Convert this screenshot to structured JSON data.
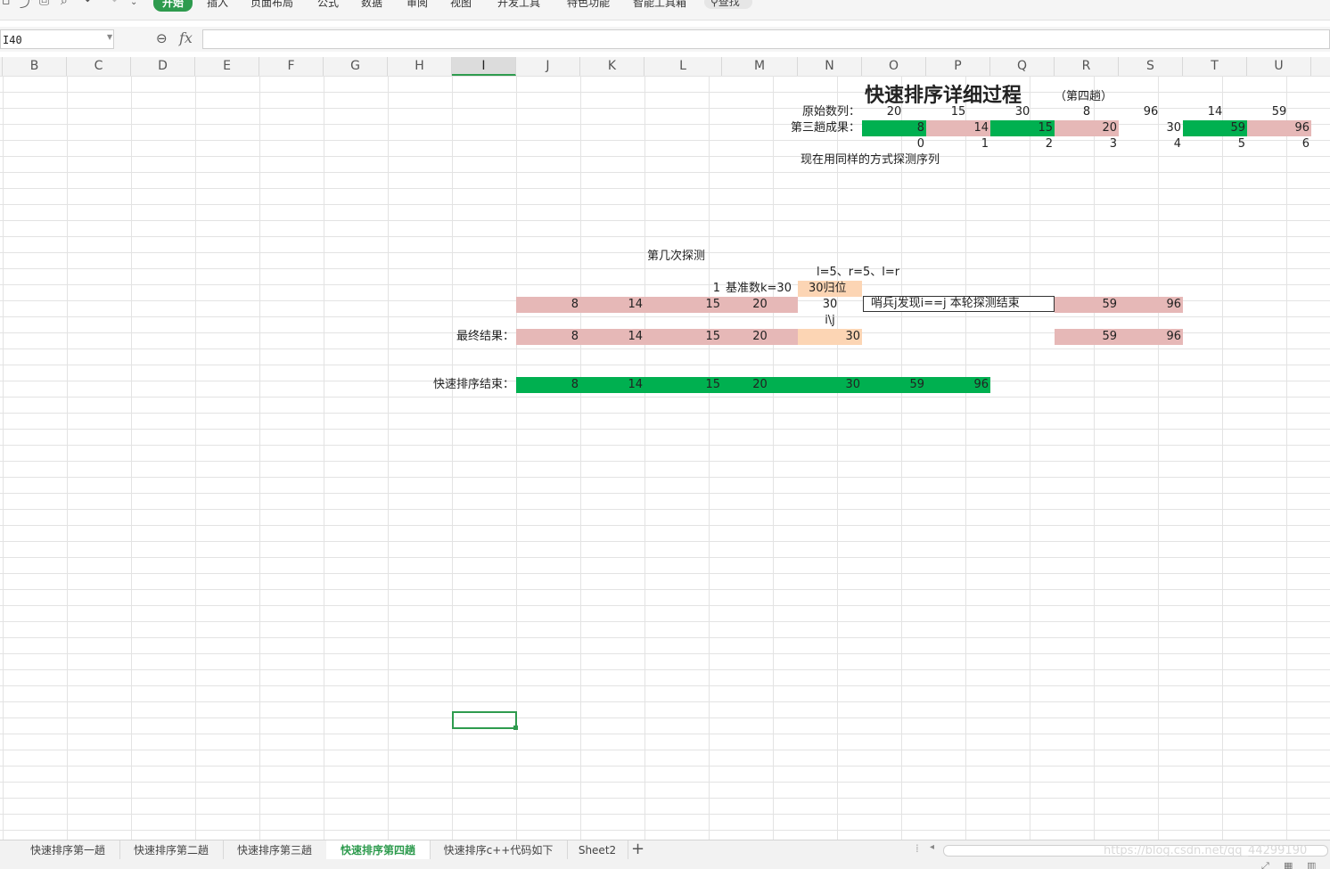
{
  "ribbon": {
    "tabs": [
      "开始",
      "插入",
      "页面布局",
      "公式",
      "数据",
      "审阅",
      "视图",
      "开发工具",
      "特色功能",
      "智能工具箱"
    ],
    "active_tab": "开始",
    "search_label": "查找"
  },
  "formula_bar": {
    "cell_ref": "I40",
    "fx_label": "fx",
    "formula": ""
  },
  "columns": [
    "B",
    "C",
    "D",
    "E",
    "F",
    "G",
    "H",
    "I",
    "J",
    "K",
    "L",
    "M",
    "N",
    "O",
    "P",
    "Q",
    "R",
    "S",
    "T",
    "U"
  ],
  "selected_column": "I",
  "sheet": {
    "title": "快速排序详细过程",
    "subtitle": "（第四趟）",
    "original_label": "原始数列：",
    "original_values": [
      "20",
      "15",
      "30",
      "8",
      "96",
      "14",
      "59"
    ],
    "third_pass_label": "第三趟成果：",
    "third_pass_values": [
      "8",
      "14",
      "15",
      "20",
      "30",
      "59",
      "96"
    ],
    "indices": [
      "0",
      "1",
      "2",
      "3",
      "4",
      "5",
      "6"
    ],
    "note": "现在用同样的方式探测序列",
    "probe_label": "第几次探测",
    "probe_pointers": "l=5、r=5、l=r",
    "probe_number": "1",
    "pivot_label": "基准数k=30",
    "pivot_home": "30归位",
    "probe_row": [
      "8",
      "14",
      "15",
      "20",
      "30"
    ],
    "sentinel_message": "哨兵j发现i==j 本轮探测结束",
    "probe_row_tail": [
      "59",
      "96"
    ],
    "pointer_label": "i\\j",
    "final_label": "最终结果：",
    "final_values": [
      "8",
      "14",
      "15",
      "20",
      "30"
    ],
    "final_tail": [
      "59",
      "96"
    ],
    "end_label": "快速排序结束：",
    "end_values": [
      "8",
      "14",
      "15",
      "20",
      "30",
      "59",
      "96"
    ]
  },
  "sheet_tabs": [
    "快速排序第一趟",
    "快速排序第二趟",
    "快速排序第三趟",
    "快速排序第四趟",
    "快速排序c++代码如下",
    "Sheet2"
  ],
  "active_sheet": "快速排序第四趟",
  "watermark": "https://blog.csdn.net/qq_44299190",
  "colors": {
    "green": "#00b050",
    "pink": "#e6b8b7",
    "peach": "#fcd5b4",
    "accent": "#2e9b4e"
  }
}
